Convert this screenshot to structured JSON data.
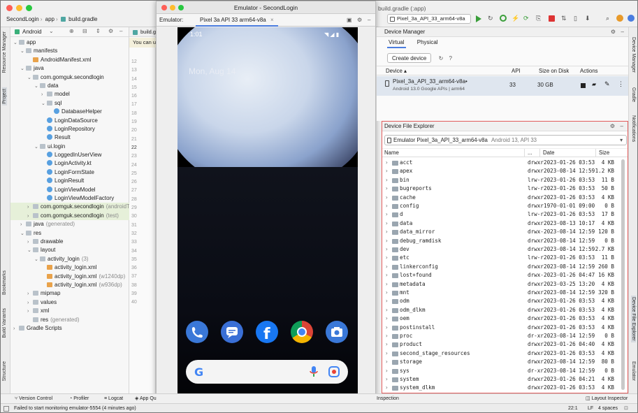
{
  "ide": {
    "breadcrumbs": [
      "SecondLogin",
      "app",
      "build.gradle"
    ],
    "window_title_fragment": "build.gradle (:app)",
    "device_selector": "Pixel_3a_API_33_arm64-v8a",
    "project_view": "Android",
    "editor_tab": "build.g",
    "editor_banner": "You can u"
  },
  "left_stripe": [
    "Resource Manager",
    "Project",
    "Bookmarks",
    "Build Variants",
    "Structure"
  ],
  "right_stripe": [
    "Device Manager",
    "Gradle",
    "Notifications",
    "Device File Explorer",
    "Emulator"
  ],
  "tree": [
    {
      "label": "app",
      "type": "folder",
      "indent": 0,
      "exp": "v"
    },
    {
      "label": "manifests",
      "type": "folder",
      "indent": 1,
      "exp": "v"
    },
    {
      "label": "AndroidManifest.xml",
      "type": "xml",
      "indent": 2,
      "exp": ""
    },
    {
      "label": "java",
      "type": "folder",
      "indent": 1,
      "exp": "v"
    },
    {
      "label": "com.gomguk.secondlogin",
      "type": "folder",
      "indent": 2,
      "exp": "v"
    },
    {
      "label": "data",
      "type": "folder",
      "indent": 3,
      "exp": "v"
    },
    {
      "label": "model",
      "type": "folder",
      "indent": 4,
      "exp": ">"
    },
    {
      "label": "sql",
      "type": "folder",
      "indent": 4,
      "exp": "v"
    },
    {
      "label": "DatabaseHelper",
      "type": "class",
      "indent": 5,
      "exp": ""
    },
    {
      "label": "LoginDataSource",
      "type": "class",
      "indent": 4,
      "exp": ""
    },
    {
      "label": "LoginRepository",
      "type": "class",
      "indent": 4,
      "exp": ""
    },
    {
      "label": "Result",
      "type": "class",
      "indent": 4,
      "exp": ""
    },
    {
      "label": "ui.login",
      "type": "folder",
      "indent": 3,
      "exp": "v"
    },
    {
      "label": "LoggedInUserView",
      "type": "class",
      "indent": 4,
      "exp": ""
    },
    {
      "label": "LoginActivity.kt",
      "type": "class",
      "indent": 4,
      "exp": ""
    },
    {
      "label": "LoginFormState",
      "type": "class",
      "indent": 4,
      "exp": ""
    },
    {
      "label": "LoginResult",
      "type": "class",
      "indent": 4,
      "exp": ""
    },
    {
      "label": "LoginViewModel",
      "type": "class",
      "indent": 4,
      "exp": ""
    },
    {
      "label": "LoginViewModelFactory",
      "type": "class",
      "indent": 4,
      "exp": ""
    },
    {
      "label": "com.gomguk.secondlogin",
      "type": "folder",
      "indent": 2,
      "exp": ">",
      "suffix": "(androidTes",
      "hl": true
    },
    {
      "label": "com.gomguk.secondlogin",
      "type": "folder",
      "indent": 2,
      "exp": ">",
      "suffix": "(test)",
      "hl": true
    },
    {
      "label": "java",
      "type": "folder",
      "indent": 1,
      "exp": ">",
      "suffix": "(generated)"
    },
    {
      "label": "res",
      "type": "folder",
      "indent": 1,
      "exp": "v"
    },
    {
      "label": "drawable",
      "type": "folder",
      "indent": 2,
      "exp": ">"
    },
    {
      "label": "layout",
      "type": "folder",
      "indent": 2,
      "exp": "v"
    },
    {
      "label": "activity_login",
      "type": "folder",
      "indent": 3,
      "exp": "v",
      "suffix": "(3)"
    },
    {
      "label": "activity_login.xml",
      "type": "xml",
      "indent": 4,
      "exp": ""
    },
    {
      "label": "activity_login.xml",
      "type": "xml",
      "indent": 4,
      "exp": "",
      "suffix": "(w1240dp)"
    },
    {
      "label": "activity_login.xml",
      "type": "xml",
      "indent": 4,
      "exp": "",
      "suffix": "(w936dp)"
    },
    {
      "label": "mipmap",
      "type": "folder",
      "indent": 2,
      "exp": ">"
    },
    {
      "label": "values",
      "type": "folder",
      "indent": 2,
      "exp": ">"
    },
    {
      "label": "xml",
      "type": "folder",
      "indent": 2,
      "exp": ">"
    },
    {
      "label": "res",
      "type": "folder",
      "indent": 2,
      "exp": "",
      "suffix": "(generated)"
    },
    {
      "label": "Gradle Scripts",
      "type": "folder",
      "indent": 0,
      "exp": ">"
    }
  ],
  "gutter_lines": [
    "12",
    "13",
    "14",
    "15",
    "16",
    "17",
    "18",
    "19",
    "20",
    "21",
    "22",
    "23",
    "24",
    "25",
    "26",
    "27",
    "28",
    "29",
    "30",
    "31",
    "32",
    "33",
    "34",
    "35",
    "36",
    "37",
    "38",
    "39",
    "40"
  ],
  "gutter_current": "22",
  "emulator": {
    "title": "Emulator - SecondLogin",
    "label": "Emulator:",
    "tab": "Pixel 3a API 33 arm64-v8a",
    "time": "1:01",
    "date": "Mon, Aug 14"
  },
  "device_manager": {
    "title": "Device Manager",
    "tabs": [
      "Virtual",
      "Physical"
    ],
    "create_button": "Create device",
    "columns": [
      "Device",
      "API",
      "Size on Disk",
      "Actions"
    ],
    "device_name": "Pixel_3a_API_33_arm64-v8a",
    "device_sub": "Android 13.0 Google APIs | arm64",
    "api": "33",
    "size": "30 GB"
  },
  "file_explorer": {
    "title": "Device File Explorer",
    "device": "Emulator Pixel_3a_API_33_arm64-v8a",
    "device_suffix": "Android 13, API 33",
    "columns": [
      "Name",
      "...",
      "Date",
      "Size"
    ],
    "rows": [
      {
        "name": "acct",
        "perm": "drwxr",
        "date": "2023-01-26 03:53",
        "size": "4 KB"
      },
      {
        "name": "apex",
        "perm": "drwxr",
        "date": "2023-08-14 12:59",
        "size": "1.2 KB"
      },
      {
        "name": "bin",
        "perm": "lrw-r",
        "date": "2023-01-26 03:53",
        "size": "11 B"
      },
      {
        "name": "bugreports",
        "perm": "lrw-r",
        "date": "2023-01-26 03:53",
        "size": "50 B"
      },
      {
        "name": "cache",
        "perm": "drwxr",
        "date": "2023-01-26 03:53",
        "size": "4 KB"
      },
      {
        "name": "config",
        "perm": "drwxr",
        "date": "1970-01-01 09:00",
        "size": "0 B"
      },
      {
        "name": "d",
        "perm": "lrw-r",
        "date": "2023-01-26 03:53",
        "size": "17 B"
      },
      {
        "name": "data",
        "perm": "drwxr",
        "date": "2023-08-13 10:17",
        "size": "4 KB"
      },
      {
        "name": "data_mirror",
        "perm": "drwx-",
        "date": "2023-08-14 12:59",
        "size": "120 B"
      },
      {
        "name": "debug_ramdisk",
        "perm": "drwxr",
        "date": "2023-08-14 12:59",
        "size": "0 B"
      },
      {
        "name": "dev",
        "perm": "drwxr",
        "date": "2023-08-14 12:59",
        "size": "2.7 KB"
      },
      {
        "name": "etc",
        "perm": "lrw-r",
        "date": "2023-01-26 03:53",
        "size": "11 B"
      },
      {
        "name": "linkerconfig",
        "perm": "drwxr",
        "date": "2023-08-14 12:59",
        "size": "260 B"
      },
      {
        "name": "lost+found",
        "perm": "drwx-",
        "date": "2023-01-26 04:47",
        "size": "16 KB"
      },
      {
        "name": "metadata",
        "perm": "drwxr",
        "date": "2023-03-25 13:20",
        "size": "4 KB"
      },
      {
        "name": "mnt",
        "perm": "drwxr",
        "date": "2023-08-14 12:59",
        "size": "320 B"
      },
      {
        "name": "odm",
        "perm": "drwxr",
        "date": "2023-01-26 03:53",
        "size": "4 KB"
      },
      {
        "name": "odm_dlkm",
        "perm": "drwxr",
        "date": "2023-01-26 03:53",
        "size": "4 KB"
      },
      {
        "name": "oem",
        "perm": "drwxr",
        "date": "2023-01-26 03:53",
        "size": "4 KB"
      },
      {
        "name": "postinstall",
        "perm": "drwxr",
        "date": "2023-01-26 03:53",
        "size": "4 KB"
      },
      {
        "name": "proc",
        "perm": "dr-xr",
        "date": "2023-08-14 12:59",
        "size": "0 B"
      },
      {
        "name": "product",
        "perm": "drwxr",
        "date": "2023-01-26 04:40",
        "size": "4 KB"
      },
      {
        "name": "second_stage_resources",
        "perm": "drwxr",
        "date": "2023-01-26 03:53",
        "size": "4 KB"
      },
      {
        "name": "storage",
        "perm": "drwxr",
        "date": "2023-08-14 12:59",
        "size": "80 B"
      },
      {
        "name": "sys",
        "perm": "dr-xr",
        "date": "2023-08-14 12:59",
        "size": "0 B"
      },
      {
        "name": "system",
        "perm": "drwxr",
        "date": "2023-01-26 04:21",
        "size": "4 KB"
      },
      {
        "name": "system_dlkm",
        "perm": "drwxr",
        "date": "2023-01-26 03:53",
        "size": "4 KB"
      }
    ]
  },
  "bottom_tabs": [
    "Version Control",
    "Profiler",
    "Logcat",
    "App Qu",
    "Inspection",
    "Layout Inspector"
  ],
  "status": {
    "message": "Failed to start monitoring emulator-5554 (4 minutes ago)",
    "position": "22:1",
    "lf": "LF",
    "indent": "4 spaces"
  },
  "colors": {
    "accent": "#4a7de0",
    "highlight_border": "#e25c5c",
    "run_green": "#3a9e3a"
  }
}
